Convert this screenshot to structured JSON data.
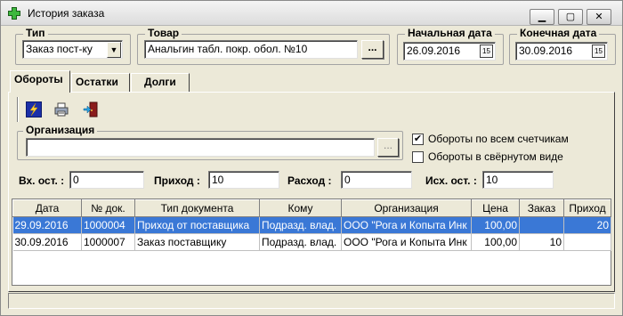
{
  "window": {
    "title": "История заказа",
    "icon": "green-cross-icon"
  },
  "filters": {
    "type_label": "Тип",
    "type_value": "Заказ пост-ку",
    "product_label": "Товар",
    "product_value": "Анальгин табл. покр. обол. №10",
    "browse_label": "...",
    "start_date_label": "Начальная дата",
    "start_date_value": "26.09.2016",
    "end_date_label": "Конечная дата",
    "end_date_value": "30.09.2016"
  },
  "tabs": [
    {
      "label": "Обороты",
      "active": true
    },
    {
      "label": "Остатки",
      "active": false
    },
    {
      "label": "Долги",
      "active": false
    }
  ],
  "toolbar": {
    "icons": [
      "lightning-icon",
      "printer-icon",
      "exit-door-icon"
    ]
  },
  "organization": {
    "label": "Организация",
    "value": "",
    "browse_label": "..."
  },
  "options": {
    "all_counters_label": "Обороты по всем счетчикам",
    "all_counters_checked": true,
    "collapsed_label": "Обороты в свёрнутом виде",
    "collapsed_checked": false
  },
  "summary": {
    "in_balance_label": "Вх. ост. :",
    "in_balance_value": "0",
    "income_label": "Приход :",
    "income_value": "10",
    "outgo_label": "Расход :",
    "outgo_value": "0",
    "out_balance_label": "Исх. ост. :",
    "out_balance_value": "10"
  },
  "table": {
    "columns": [
      "Дата",
      "№ док.",
      "Тип документа",
      "Кому",
      "Организация",
      "Цена",
      "Заказ",
      "Приход"
    ],
    "rows": [
      [
        "29.09.2016",
        "1000004",
        "Приход от поставщика",
        "Подразд. влад.",
        "ООО \"Рога и Копыта Инк",
        "100,00",
        "",
        "20"
      ],
      [
        "30.09.2016",
        "1000007",
        "Заказ поставщику",
        "Подразд. влад.",
        "ООО \"Рога и Копыта Инк",
        "100,00",
        "10",
        ""
      ]
    ],
    "selected_row": 0
  }
}
